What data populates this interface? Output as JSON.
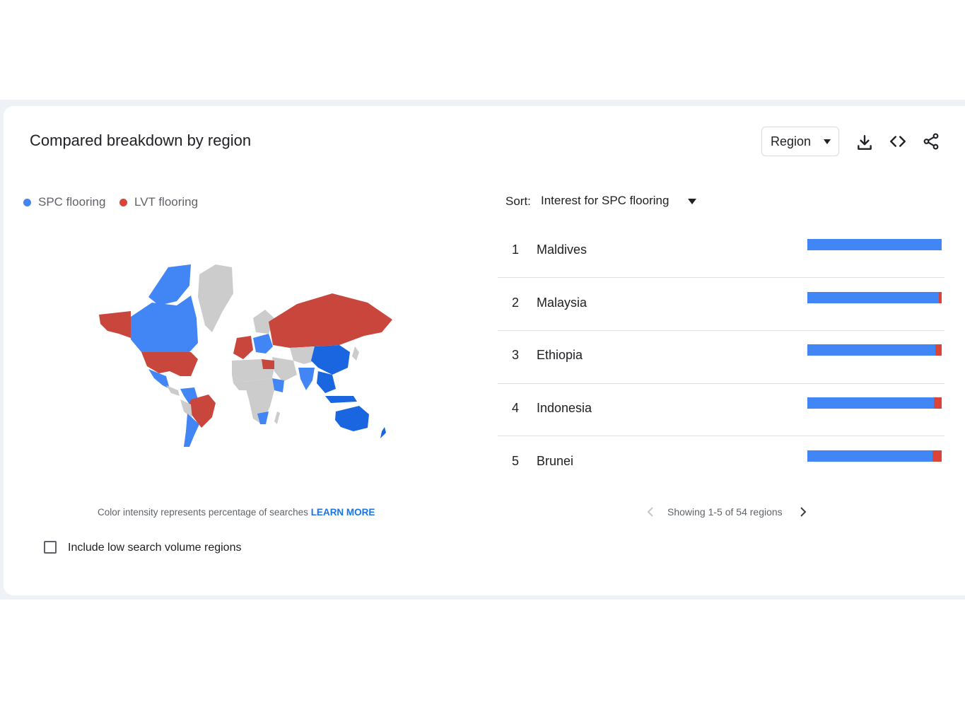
{
  "card": {
    "title": "Compared breakdown by region",
    "region_select": "Region",
    "download_icon": "download-icon",
    "embed_icon": "code-icon",
    "share_icon": "share-icon"
  },
  "legend": [
    {
      "label": "SPC flooring",
      "color": "#4285f4"
    },
    {
      "label": "LVT flooring",
      "color": "#db4437"
    }
  ],
  "map": {
    "caption": "Color intensity represents percentage of searches",
    "learn_more": "LEARN MORE"
  },
  "low_volume": {
    "label": "Include low search volume regions",
    "checked": false
  },
  "sort": {
    "label": "Sort:",
    "value": "Interest for SPC flooring"
  },
  "regions": [
    {
      "rank": "1",
      "name": "Maldives",
      "spc_share": 1.0,
      "lvt_share": 0.0
    },
    {
      "rank": "2",
      "name": "Malaysia",
      "spc_share": 0.98,
      "lvt_share": 0.02
    },
    {
      "rank": "3",
      "name": "Ethiopia",
      "spc_share": 0.95,
      "lvt_share": 0.05
    },
    {
      "rank": "4",
      "name": "Indonesia",
      "spc_share": 0.94,
      "lvt_share": 0.06
    },
    {
      "rank": "5",
      "name": "Brunei",
      "spc_share": 0.93,
      "lvt_share": 0.07
    }
  ],
  "pager": {
    "text": "Showing 1-5 of 54 regions"
  },
  "colors": {
    "spc": "#4285f4",
    "lvt": "#db4437",
    "spc_dark": "#1a66e0",
    "lvt_dark": "#c9463d",
    "neutral": "#cccccc"
  }
}
